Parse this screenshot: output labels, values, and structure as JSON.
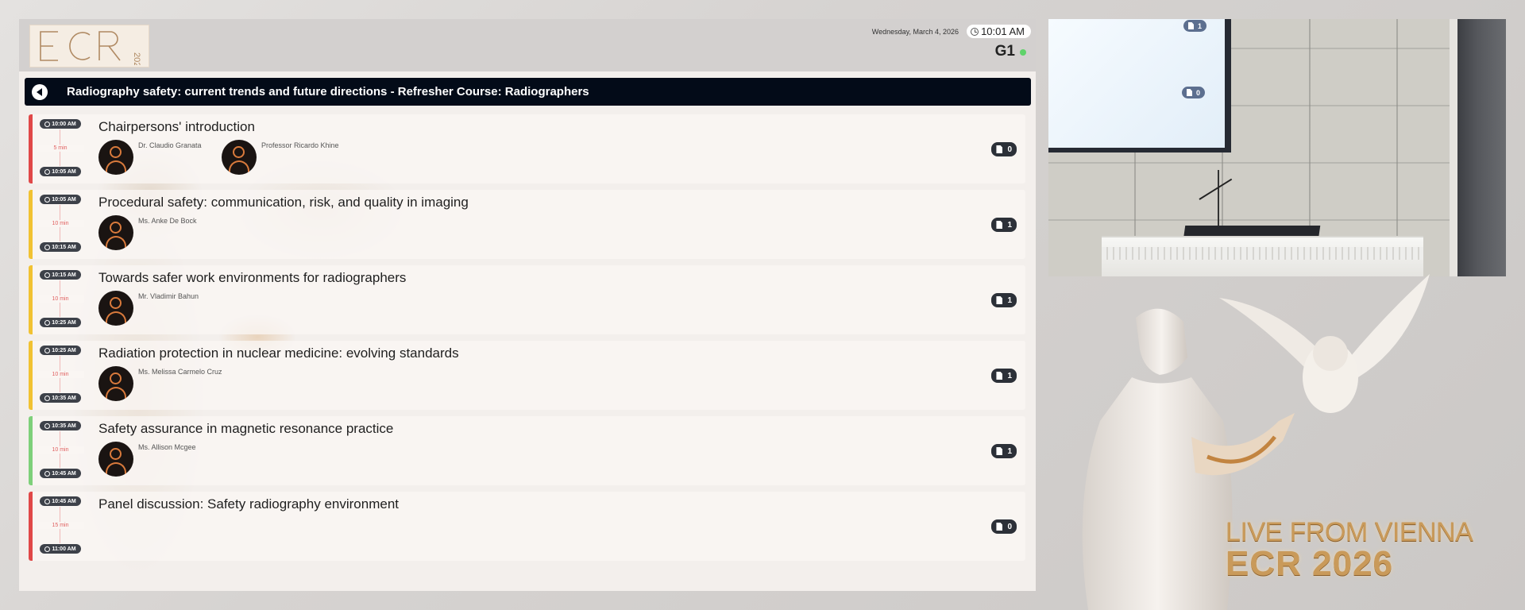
{
  "logo_text": "ECR 2026",
  "header": {
    "date": "Wednesday, March 4, 2026",
    "time": "10:01 AM",
    "room": "G1",
    "live_color": "#5fd36a"
  },
  "session": {
    "back_icon": "chevron-left-icon",
    "title": "Radiography safety: current trends and future directions - Refresher Course: Radiographers"
  },
  "items": [
    {
      "start": "10:00 AM",
      "end": "10:05 AM",
      "duration": "5 min",
      "bar_color": "#e04848",
      "title": "Chairpersons' introduction",
      "speakers": [
        "Dr. Claudio Granata",
        "Professor Ricardo Khine"
      ],
      "docs": "0"
    },
    {
      "start": "10:05 AM",
      "end": "10:15 AM",
      "duration": "10 min",
      "bar_color": "#f1c232",
      "title": "Procedural safety: communication, risk, and quality in imaging",
      "speakers": [
        "Ms. Anke De Bock"
      ],
      "docs": "1"
    },
    {
      "start": "10:15 AM",
      "end": "10:25 AM",
      "duration": "10 min",
      "bar_color": "#f1c232",
      "title": "Towards safer work environments for radiographers",
      "speakers": [
        "Mr. Vladimir Bahun"
      ],
      "docs": "1"
    },
    {
      "start": "10:25 AM",
      "end": "10:35 AM",
      "duration": "10 min",
      "bar_color": "#f1c232",
      "title": "Radiation protection in nuclear medicine: evolving standards",
      "speakers": [
        "Ms. Melissa Carmelo Cruz"
      ],
      "docs": "1"
    },
    {
      "start": "10:35 AM",
      "end": "10:45 AM",
      "duration": "10 min",
      "bar_color": "#7ed07a",
      "title": "Safety assurance in magnetic resonance practice",
      "speakers": [
        "Ms. Allison Mcgee"
      ],
      "docs": "1"
    },
    {
      "start": "10:45 AM",
      "end": "11:00 AM",
      "duration": "15 min",
      "bar_color": "#e04848",
      "title": "Panel discussion: Safety radiography environment",
      "speakers": [],
      "docs": "0"
    }
  ],
  "video": {
    "badge_top": "1",
    "badge_mid": "0"
  },
  "branding": {
    "live": "LIVE FROM VIENNA",
    "ecr": "ECR 2026"
  }
}
